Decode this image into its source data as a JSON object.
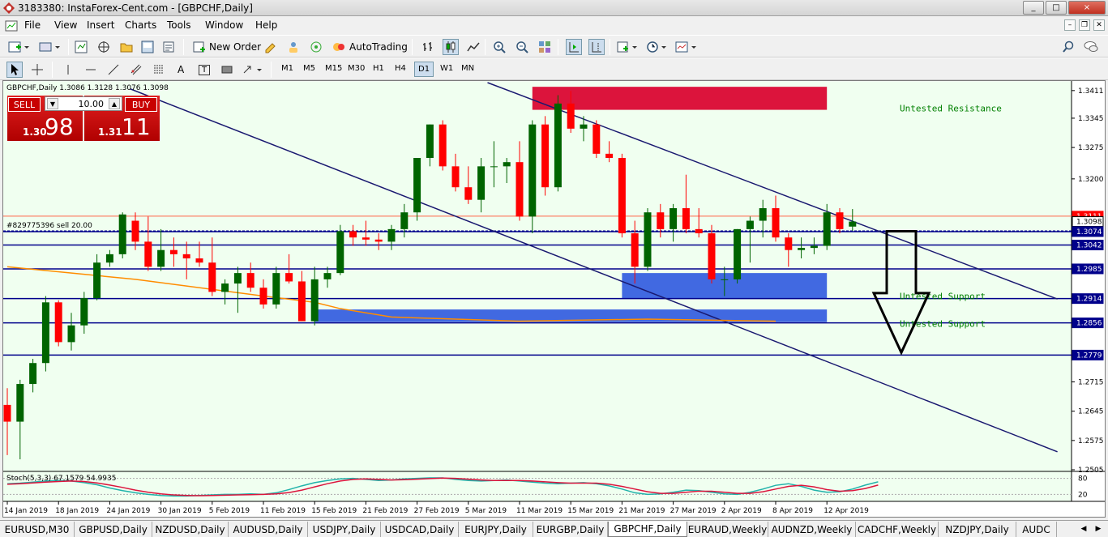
{
  "window": {
    "title": "3183380: InstaForex-Cent.com - [GBPCHF,Daily]",
    "controls": [
      "_",
      "□",
      "×"
    ]
  },
  "menu": [
    "File",
    "View",
    "Insert",
    "Charts",
    "Tools",
    "Window",
    "Help"
  ],
  "toolbar1": {
    "new_order": "New Order",
    "autotrading": "AutoTrading"
  },
  "toolbar2": {
    "text_tool": "A",
    "label_tool": "T",
    "timeframes": [
      "M1",
      "M5",
      "M15",
      "M30",
      "H1",
      "H4",
      "D1",
      "W1",
      "MN"
    ],
    "active_timeframe": "D1"
  },
  "chart": {
    "header": "GBPCHF,Daily  1.3086 1.3128 1.3076 1.3098",
    "order_line_label": "#829775396 sell 20.00",
    "stoch_label": "Stoch(5,3,3) 67.1579 54.9935",
    "labels": {
      "resistance": "Untested Resistance",
      "support1": "Untested Support",
      "support2": "Untested Support"
    },
    "colors": {
      "bull": "#006400",
      "bear": "#ff0000",
      "level_line": "#00008b",
      "resistance_zone": "#dc143c",
      "support_zone": "#4169e1",
      "ma": "#ff8c00",
      "background": "#f0fff0"
    }
  },
  "trade_panel": {
    "sell_label": "SELL",
    "buy_label": "BUY",
    "lot": "10.00",
    "sell_prefix": "1.30",
    "sell_big": "98",
    "buy_prefix": "1.31",
    "buy_big": "11"
  },
  "chart_data": {
    "type": "candlestick",
    "symbol": "GBPCHF",
    "timeframe": "Daily",
    "y_ticks": [
      "1.3411",
      "1.3345",
      "1.3275",
      "1.3200",
      "1.3115",
      "1.3042",
      "1.2985",
      "1.2914",
      "1.2856",
      "1.2779",
      "1.2715",
      "1.2645",
      "1.2575",
      "1.2505"
    ],
    "ylim": [
      1.2505,
      1.343
    ],
    "price_tags": [
      {
        "label": "1.3111",
        "price": 1.3111,
        "bg": "#ff0000"
      },
      {
        "label": "1.3098",
        "price": 1.3098,
        "bg": "#ffffff"
      },
      {
        "label": "1.3074",
        "price": 1.3074,
        "bg": "#00008b"
      },
      {
        "label": "1.3042",
        "price": 1.3042,
        "bg": "#00008b"
      },
      {
        "label": "1.2985",
        "price": 1.2985,
        "bg": "#00008b"
      },
      {
        "label": "1.2914",
        "price": 1.2914,
        "bg": "#00008b"
      },
      {
        "label": "1.2856",
        "price": 1.2856,
        "bg": "#00008b"
      },
      {
        "label": "1.2779",
        "price": 1.2779,
        "bg": "#00008b"
      }
    ],
    "levels": [
      1.3074,
      1.3042,
      1.2985,
      1.2914,
      1.2856,
      1.2779
    ],
    "x_labels": [
      "14 Jan 2019",
      "18 Jan 2019",
      "24 Jan 2019",
      "30 Jan 2019",
      "5 Feb 2019",
      "11 Feb 2019",
      "15 Feb 2019",
      "21 Feb 2019",
      "27 Feb 2019",
      "5 Mar 2019",
      "11 Mar 2019",
      "15 Mar 2019",
      "21 Mar 2019",
      "27 Mar 2019",
      "2 Apr 2019",
      "8 Apr 2019",
      "12 Apr 2019"
    ],
    "candles": [
      {
        "o": 1.266,
        "h": 1.27,
        "l": 1.254,
        "c": 1.262
      },
      {
        "o": 1.262,
        "h": 1.272,
        "l": 1.253,
        "c": 1.271
      },
      {
        "o": 1.271,
        "h": 1.277,
        "l": 1.269,
        "c": 1.276
      },
      {
        "o": 1.276,
        "h": 1.292,
        "l": 1.274,
        "c": 1.2905
      },
      {
        "o": 1.2905,
        "h": 1.291,
        "l": 1.28,
        "c": 1.281
      },
      {
        "o": 1.281,
        "h": 1.288,
        "l": 1.279,
        "c": 1.285
      },
      {
        "o": 1.285,
        "h": 1.293,
        "l": 1.283,
        "c": 1.2915
      },
      {
        "o": 1.2915,
        "h": 1.302,
        "l": 1.291,
        "c": 1.3
      },
      {
        "o": 1.3,
        "h": 1.303,
        "l": 1.299,
        "c": 1.302
      },
      {
        "o": 1.302,
        "h": 1.312,
        "l": 1.301,
        "c": 1.3115
      },
      {
        "o": 1.31,
        "h": 1.312,
        "l": 1.303,
        "c": 1.305
      },
      {
        "o": 1.305,
        "h": 1.311,
        "l": 1.298,
        "c": 1.299
      },
      {
        "o": 1.299,
        "h": 1.308,
        "l": 1.298,
        "c": 1.303
      },
      {
        "o": 1.303,
        "h": 1.306,
        "l": 1.299,
        "c": 1.302
      },
      {
        "o": 1.302,
        "h": 1.305,
        "l": 1.296,
        "c": 1.301
      },
      {
        "o": 1.301,
        "h": 1.305,
        "l": 1.299,
        "c": 1.3
      },
      {
        "o": 1.3,
        "h": 1.306,
        "l": 1.292,
        "c": 1.293
      },
      {
        "o": 1.293,
        "h": 1.296,
        "l": 1.29,
        "c": 1.295
      },
      {
        "o": 1.295,
        "h": 1.299,
        "l": 1.288,
        "c": 1.2975
      },
      {
        "o": 1.2975,
        "h": 1.3,
        "l": 1.293,
        "c": 1.294
      },
      {
        "o": 1.294,
        "h": 1.296,
        "l": 1.289,
        "c": 1.29
      },
      {
        "o": 1.29,
        "h": 1.299,
        "l": 1.289,
        "c": 1.2975
      },
      {
        "o": 1.2975,
        "h": 1.302,
        "l": 1.295,
        "c": 1.2955
      },
      {
        "o": 1.2955,
        "h": 1.298,
        "l": 1.286,
        "c": 1.286
      },
      {
        "o": 1.286,
        "h": 1.299,
        "l": 1.285,
        "c": 1.296
      },
      {
        "o": 1.296,
        "h": 1.299,
        "l": 1.294,
        "c": 1.2975
      },
      {
        "o": 1.2975,
        "h": 1.309,
        "l": 1.297,
        "c": 1.3075
      },
      {
        "o": 1.3075,
        "h": 1.309,
        "l": 1.304,
        "c": 1.306
      },
      {
        "o": 1.306,
        "h": 1.31,
        "l": 1.304,
        "c": 1.3055
      },
      {
        "o": 1.3055,
        "h": 1.307,
        "l": 1.303,
        "c": 1.305
      },
      {
        "o": 1.305,
        "h": 1.309,
        "l": 1.303,
        "c": 1.308
      },
      {
        "o": 1.308,
        "h": 1.314,
        "l": 1.306,
        "c": 1.312
      },
      {
        "o": 1.312,
        "h": 1.325,
        "l": 1.31,
        "c": 1.325
      },
      {
        "o": 1.325,
        "h": 1.333,
        "l": 1.323,
        "c": 1.333
      },
      {
        "o": 1.333,
        "h": 1.334,
        "l": 1.322,
        "c": 1.323
      },
      {
        "o": 1.323,
        "h": 1.326,
        "l": 1.317,
        "c": 1.318
      },
      {
        "o": 1.318,
        "h": 1.323,
        "l": 1.314,
        "c": 1.315
      },
      {
        "o": 1.315,
        "h": 1.325,
        "l": 1.312,
        "c": 1.323
      },
      {
        "o": 1.323,
        "h": 1.329,
        "l": 1.318,
        "c": 1.323
      },
      {
        "o": 1.323,
        "h": 1.325,
        "l": 1.319,
        "c": 1.324
      },
      {
        "o": 1.324,
        "h": 1.329,
        "l": 1.31,
        "c": 1.311
      },
      {
        "o": 1.311,
        "h": 1.334,
        "l": 1.307,
        "c": 1.333
      },
      {
        "o": 1.333,
        "h": 1.335,
        "l": 1.316,
        "c": 1.318
      },
      {
        "o": 1.318,
        "h": 1.34,
        "l": 1.317,
        "c": 1.338
      },
      {
        "o": 1.338,
        "h": 1.341,
        "l": 1.331,
        "c": 1.332
      },
      {
        "o": 1.332,
        "h": 1.335,
        "l": 1.329,
        "c": 1.333
      },
      {
        "o": 1.333,
        "h": 1.334,
        "l": 1.325,
        "c": 1.326
      },
      {
        "o": 1.326,
        "h": 1.329,
        "l": 1.324,
        "c": 1.325
      },
      {
        "o": 1.325,
        "h": 1.326,
        "l": 1.306,
        "c": 1.307
      },
      {
        "o": 1.307,
        "h": 1.31,
        "l": 1.295,
        "c": 1.299
      },
      {
        "o": 1.299,
        "h": 1.313,
        "l": 1.298,
        "c": 1.312
      },
      {
        "o": 1.312,
        "h": 1.314,
        "l": 1.306,
        "c": 1.308
      },
      {
        "o": 1.308,
        "h": 1.314,
        "l": 1.305,
        "c": 1.313
      },
      {
        "o": 1.313,
        "h": 1.321,
        "l": 1.307,
        "c": 1.308
      },
      {
        "o": 1.308,
        "h": 1.313,
        "l": 1.306,
        "c": 1.307
      },
      {
        "o": 1.307,
        "h": 1.309,
        "l": 1.295,
        "c": 1.296
      },
      {
        "o": 1.296,
        "h": 1.299,
        "l": 1.292,
        "c": 1.296
      },
      {
        "o": 1.296,
        "h": 1.308,
        "l": 1.295,
        "c": 1.308
      },
      {
        "o": 1.308,
        "h": 1.311,
        "l": 1.3,
        "c": 1.31
      },
      {
        "o": 1.31,
        "h": 1.315,
        "l": 1.306,
        "c": 1.313
      },
      {
        "o": 1.313,
        "h": 1.316,
        "l": 1.305,
        "c": 1.306
      },
      {
        "o": 1.306,
        "h": 1.307,
        "l": 1.299,
        "c": 1.303
      },
      {
        "o": 1.303,
        "h": 1.306,
        "l": 1.301,
        "c": 1.3035
      },
      {
        "o": 1.3035,
        "h": 1.306,
        "l": 1.302,
        "c": 1.304
      },
      {
        "o": 1.304,
        "h": 1.314,
        "l": 1.303,
        "c": 1.312
      },
      {
        "o": 1.312,
        "h": 1.313,
        "l": 1.307,
        "c": 1.308
      },
      {
        "o": 1.3086,
        "h": 1.3128,
        "l": 1.3076,
        "c": 1.3098
      }
    ],
    "ma_points": [
      [
        0,
        1.299
      ],
      [
        10,
        1.296
      ],
      [
        20,
        1.292
      ],
      [
        24,
        1.2905
      ],
      [
        26,
        1.289
      ],
      [
        30,
        1.287
      ],
      [
        40,
        1.286
      ],
      [
        50,
        1.2865
      ],
      [
        60,
        1.286
      ]
    ],
    "resistance_zone": {
      "x0": 41,
      "x1": 64,
      "y0": 1.3365,
      "y1": 1.342
    },
    "support_zone_upper": {
      "x0": 48,
      "x1": 64,
      "y0": 1.2914,
      "y1": 1.2975
    },
    "support_zone_lower": {
      "x0": 24,
      "x1": 64,
      "y0": 1.2858,
      "y1": 1.2888
    },
    "stochastic": {
      "main": [
        60,
        62,
        66,
        70,
        72,
        70,
        64,
        56,
        44,
        34,
        26,
        20,
        16,
        14,
        14,
        16,
        18,
        20,
        20,
        22,
        20,
        26,
        38,
        52,
        64,
        72,
        78,
        80,
        76,
        72,
        74,
        78,
        80,
        82,
        82,
        76,
        72,
        70,
        72,
        74,
        70,
        66,
        62,
        60,
        62,
        64,
        60,
        52,
        40,
        26,
        20,
        22,
        28,
        36,
        34,
        28,
        22,
        20,
        28,
        40,
        54,
        60,
        50,
        36,
        28,
        30,
        40,
        55,
        67
      ],
      "signal": [
        58,
        60,
        63,
        66,
        68,
        70,
        68,
        63,
        55,
        46,
        36,
        28,
        22,
        18,
        16,
        15,
        16,
        17,
        18,
        19,
        20,
        22,
        27,
        36,
        48,
        60,
        70,
        76,
        78,
        76,
        74,
        75,
        77,
        79,
        81,
        80,
        77,
        74,
        72,
        72,
        72,
        70,
        67,
        64,
        62,
        62,
        62,
        58,
        50,
        40,
        30,
        24,
        24,
        28,
        32,
        32,
        28,
        24,
        24,
        30,
        40,
        50,
        54,
        48,
        38,
        32,
        34,
        42,
        55
      ]
    }
  },
  "tabs": [
    "EURUSD,M30",
    "GBPUSD,Daily",
    "NZDUSD,Daily",
    "AUDUSD,Daily",
    "USDJPY,Daily",
    "USDCAD,Daily",
    "EURJPY,Daily",
    "EURGBP,Daily",
    "GBPCHF,Daily",
    "EURAUD,Weekly",
    "AUDNZD,Weekly",
    "CADCHF,Weekly",
    "NZDJPY,Daily",
    "AUDC"
  ],
  "active_tab": "GBPCHF,Daily"
}
